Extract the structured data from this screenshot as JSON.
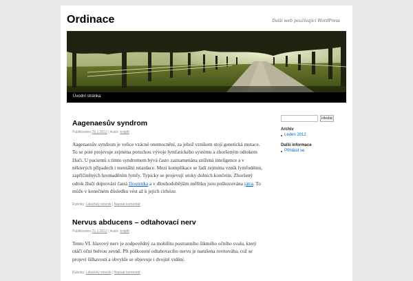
{
  "site": {
    "title": "Ordinace",
    "description": "Další web používající WordPress"
  },
  "nav": {
    "home": "Úvodní stránka"
  },
  "posts": [
    {
      "title": "Aagenaesův syndrom",
      "meta": {
        "published_label": "Publikováno",
        "date": "29.1.2012",
        "separator": "|",
        "author_label": "Autor:",
        "author": "knight"
      },
      "paragraph": {
        "text1": "Aagenaesův syndrom je velice vzácné onemocnění, za jehož vznikem stojí genetická mutace. To se poté projevuje zejména poruchou vývoje lymfatického systému a zhoršeným odtokem žluči. U pacientů s tímto syndromem bývá často zaznamenána snížená inteligence a v některých případech i mentální retardace. Mezi komplikace se řadí zejména vznik lymfodému, zapříčiněných hromaděním lymfy. Typicky se projevují otoky dolních končetin. Zhoršený odtok žluči doprovází častá ",
        "link1": "žloutenka",
        "text2": " a v dlouhodobějším měřítku jsou poškozována ",
        "link2": "játra",
        "text3": ". To může v konečném důsledku vést až k jejich cirhóze."
      },
      "utility": {
        "category_label": "Rubriky:",
        "category": "Lékařský slovník",
        "separator": "|",
        "comment": "Napsat komentář"
      }
    },
    {
      "title": "Nervus abducens – odtahovací nerv",
      "meta": {
        "published_label": "Publikováno",
        "date": "21.1.2012",
        "separator": "|",
        "author_label": "Autor:",
        "author": "knight"
      },
      "paragraph": {
        "text1": "Tento VI. hlavový nerv je zodpovědný za mobilitu postranního šikmého očního svalu, který otáčí oční bulvou zevně. Při poškození odtahovacího nervu je narušena rovnováha, což se projeví šilhavostí a obvykle se objevuje i dvojité vidění."
      },
      "utility": {
        "category_label": "Rubriky:",
        "category": "Lékařský slovník",
        "separator": "|",
        "comment": "Napsat komentář"
      }
    }
  ],
  "sidebar": {
    "search": {
      "button": "Hledat",
      "placeholder": ""
    },
    "archive": {
      "title": "Archiv",
      "items": [
        "Leden 2012"
      ]
    },
    "more": {
      "title": "Další informace",
      "items": [
        "Přihlásit se"
      ]
    }
  },
  "colors": {
    "page_bg": "#e9e9e9",
    "content_bg": "#ffffff",
    "nav_bg": "#000000",
    "link": "#0066cc"
  }
}
